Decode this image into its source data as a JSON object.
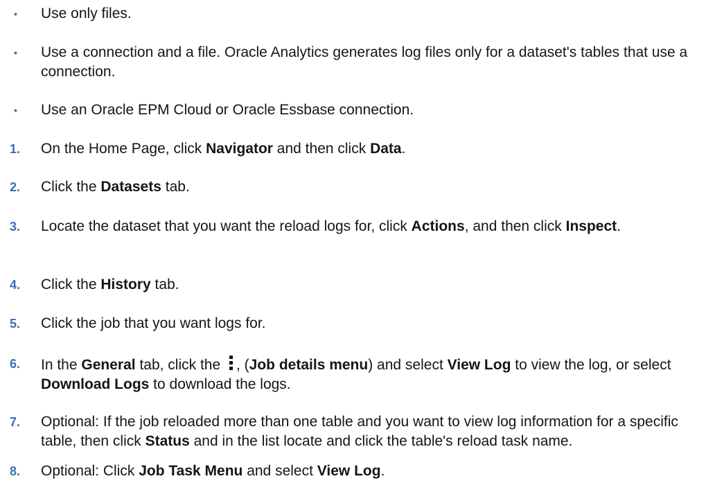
{
  "bullets": [
    {
      "marker": "•",
      "parts": [
        {
          "t": "Use only files."
        }
      ]
    },
    {
      "marker": "•",
      "parts": [
        {
          "t": "Use a connection and a file. Oracle Analytics generates log files only for a dataset's tables that use a connection."
        }
      ]
    },
    {
      "marker": "•",
      "parts": [
        {
          "t": "Use an Oracle EPM Cloud or Oracle Essbase connection."
        }
      ]
    }
  ],
  "steps": [
    {
      "marker": "1.",
      "parts": [
        {
          "t": "On the Home Page, click "
        },
        {
          "t": "Navigator",
          "b": true
        },
        {
          "t": " and then click "
        },
        {
          "t": "Data",
          "b": true
        },
        {
          "t": "."
        }
      ]
    },
    {
      "marker": "2.",
      "parts": [
        {
          "t": "Click the "
        },
        {
          "t": "Datasets",
          "b": true
        },
        {
          "t": " tab."
        }
      ]
    },
    {
      "marker": "3.",
      "parts": [
        {
          "t": "Locate the dataset that you want the reload logs for, click "
        },
        {
          "t": "Actions",
          "b": true
        },
        {
          "t": ", and then click "
        },
        {
          "t": "Inspect",
          "b": true
        },
        {
          "t": "."
        }
      ]
    },
    {
      "marker": "4.",
      "parts": [
        {
          "t": "Click the "
        },
        {
          "t": "History",
          "b": true
        },
        {
          "t": " tab."
        }
      ]
    },
    {
      "marker": "5.",
      "parts": [
        {
          "t": "Click the job that you want logs for."
        }
      ]
    },
    {
      "marker": "6.",
      "parts": [
        {
          "t": "In the "
        },
        {
          "t": "General",
          "b": true
        },
        {
          "t": " tab, click the "
        },
        {
          "icon": "kebab-menu-icon"
        },
        {
          "t": ", ("
        },
        {
          "t": "Job details menu",
          "b": true
        },
        {
          "t": ") and select "
        },
        {
          "t": "View Log",
          "b": true
        },
        {
          "t": " to view the log, or select "
        },
        {
          "t": "Download Logs",
          "b": true
        },
        {
          "t": " to download the logs."
        }
      ]
    },
    {
      "marker": "7.",
      "parts": [
        {
          "t": "Optional: If the job reloaded more than one table and you want to view log information for a specific table, then click "
        },
        {
          "t": "Status",
          "b": true
        },
        {
          "t": " and in the list locate and click the table's reload task name."
        }
      ]
    },
    {
      "marker": "8.",
      "parts": [
        {
          "t": "Optional: Click "
        },
        {
          "t": "Job Task Menu",
          "b": true
        },
        {
          "t": " and select "
        },
        {
          "t": "View Log",
          "b": true
        },
        {
          "t": "."
        }
      ]
    }
  ]
}
